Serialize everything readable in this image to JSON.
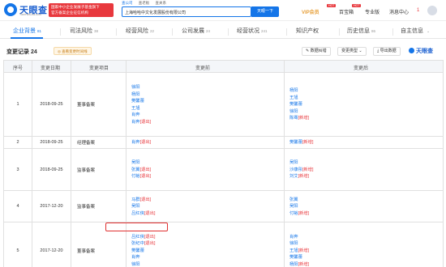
{
  "header": {
    "logo_text": "天眼查",
    "logo_sub": "TianYanCha.com",
    "badge_line1": "国家中小企业发展子基金旗下",
    "badge_line2": "官方备案企业征信机构",
    "search_tabs": [
      "查公司",
      "查老板",
      "查关系"
    ],
    "search_value": "上海哈哈中文化发展股份有限公司",
    "search_button": "天眼一下",
    "vip_label": "VIP会员",
    "hot_badge": "HOT",
    "nav_items": [
      "百宝箱",
      "专业版",
      "消息中心"
    ],
    "message_count": "1"
  },
  "tabs": [
    {
      "label": "企业背景",
      "count": "81"
    },
    {
      "label": "司法风险",
      "count": "38"
    },
    {
      "label": "经营风险",
      "count": "22"
    },
    {
      "label": "公司发展",
      "count": "24"
    },
    {
      "label": "经营状况",
      "count": "241"
    },
    {
      "label": "知识产权",
      "count": ""
    },
    {
      "label": "历史信息",
      "count": "86"
    },
    {
      "label": "自主信息",
      "count": ""
    }
  ],
  "section": {
    "title": "变更记录",
    "count": "24",
    "note": "◎ 查看变更时间线",
    "btn_data_map": "数据纠错",
    "btn_filter": "变更类型",
    "btn_export": "导出数据",
    "brand": "天眼查"
  },
  "table": {
    "headers": [
      "序号",
      "变更日期",
      "变更项目",
      "变更前",
      "变更后"
    ],
    "rows": [
      {
        "idx": "1",
        "date": "2018-09-25",
        "item": "董事备案",
        "before": [
          {
            "name": "徐阳",
            "tag": ""
          },
          {
            "name": "杨阳",
            "tag": ""
          },
          {
            "name": "樊馨蕾",
            "tag": ""
          },
          {
            "name": "王旭",
            "tag": ""
          },
          {
            "name": "肖奔",
            "tag": ""
          },
          {
            "name": "肖奔",
            "tag": "[退出]"
          }
        ],
        "after": [
          {
            "name": "杨阳",
            "tag": ""
          },
          {
            "name": "王旭",
            "tag": ""
          },
          {
            "name": "樊馨蕾",
            "tag": ""
          },
          {
            "name": "徐阳",
            "tag": ""
          },
          {
            "name": "陈骞",
            "tag": "[新增]"
          }
        ]
      },
      {
        "idx": "2",
        "date": "2018-09-25",
        "item": "经理备案",
        "before": [
          {
            "name": "肖奔",
            "tag": "[退出]"
          }
        ],
        "after": [
          {
            "name": "樊馨蕾",
            "tag": "[新增]"
          }
        ]
      },
      {
        "idx": "3",
        "date": "2018-09-25",
        "item": "监事备案",
        "before": [
          {
            "name": "吴阳",
            "tag": ""
          },
          {
            "name": "张翼",
            "tag": "[退出]"
          },
          {
            "name": "付裕",
            "tag": "[退出]"
          }
        ],
        "after": [
          {
            "name": "吴阳",
            "tag": ""
          },
          {
            "name": "沙康彤",
            "tag": "[新增]"
          },
          {
            "name": "刘艾",
            "tag": "[新增]"
          }
        ]
      },
      {
        "idx": "4",
        "date": "2017-12-20",
        "item": "监事备案",
        "before": [
          {
            "name": "马群",
            "tag": "[退出]"
          },
          {
            "name": "吴阳",
            "tag": ""
          },
          {
            "name": "吕红侠",
            "tag": "[退出]"
          }
        ],
        "after": [
          {
            "name": "张翼",
            "tag": ""
          },
          {
            "name": "吴阳",
            "tag": ""
          },
          {
            "name": "付裕",
            "tag": "[新增]"
          }
        ]
      },
      {
        "idx": "5",
        "date": "2017-12-20",
        "item": "董事备案",
        "before": [
          {
            "name": "吕红侠",
            "tag": "[退出]"
          },
          {
            "name": "张纪中",
            "tag": "[退出]"
          },
          {
            "name": "樊馨蕾",
            "tag": ""
          },
          {
            "name": "肖奔",
            "tag": ""
          },
          {
            "name": "徐阳",
            "tag": ""
          }
        ],
        "after": [
          {
            "name": "肖奔",
            "tag": ""
          },
          {
            "name": "徐阳",
            "tag": ""
          },
          {
            "name": "王旭",
            "tag": "[新增]"
          },
          {
            "name": "樊馨蕾",
            "tag": ""
          },
          {
            "name": "杨阳",
            "tag": "[新增]"
          }
        ]
      }
    ]
  },
  "colors": {
    "brand": "#1475e8",
    "exit": "#e8383d",
    "highlight": "#e03030"
  }
}
